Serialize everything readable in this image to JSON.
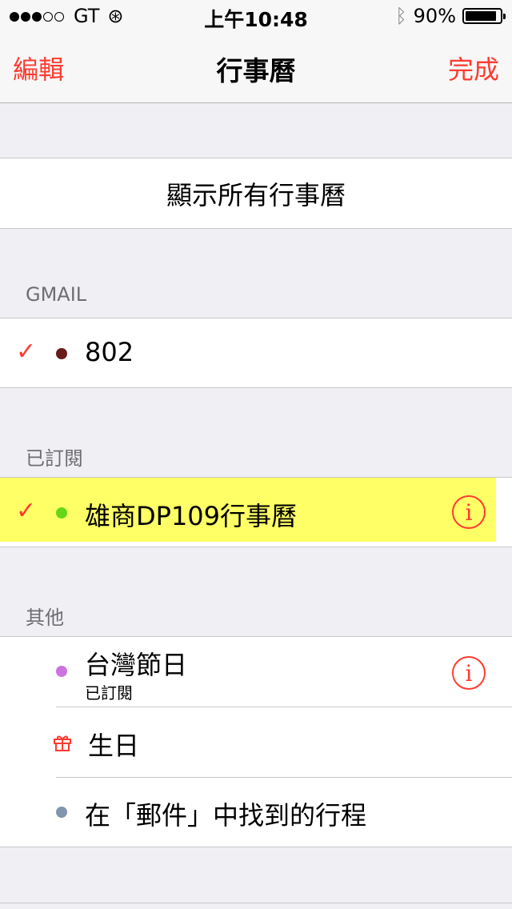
{
  "status_bar": {
    "carrier": "GT",
    "time": "上午10:48",
    "battery": "90%"
  },
  "nav": {
    "left_button": "編輯",
    "title": "行事曆",
    "right_button": "完成"
  },
  "show_all": "顯示所有行事曆",
  "sections": {
    "gmail": {
      "header": "GMAIL",
      "item": {
        "label": "802",
        "color": "#6b1a1a"
      }
    },
    "subscribed": {
      "header": "已訂閱",
      "item": {
        "label": "雄商DP109行事曆",
        "color": "#64d817",
        "highlight": "#ffff66"
      }
    },
    "other": {
      "header": "其他",
      "items": [
        {
          "label": "台灣節日",
          "sublabel": "已訂閱",
          "color": "#cc73e1"
        },
        {
          "label": "生日",
          "icon": "gift-icon"
        },
        {
          "label": "在「郵件」中找到的行程",
          "color": "#8295af"
        }
      ]
    }
  },
  "accent": "#ff3b30",
  "check_glyph": "✓",
  "info_glyph": "i"
}
